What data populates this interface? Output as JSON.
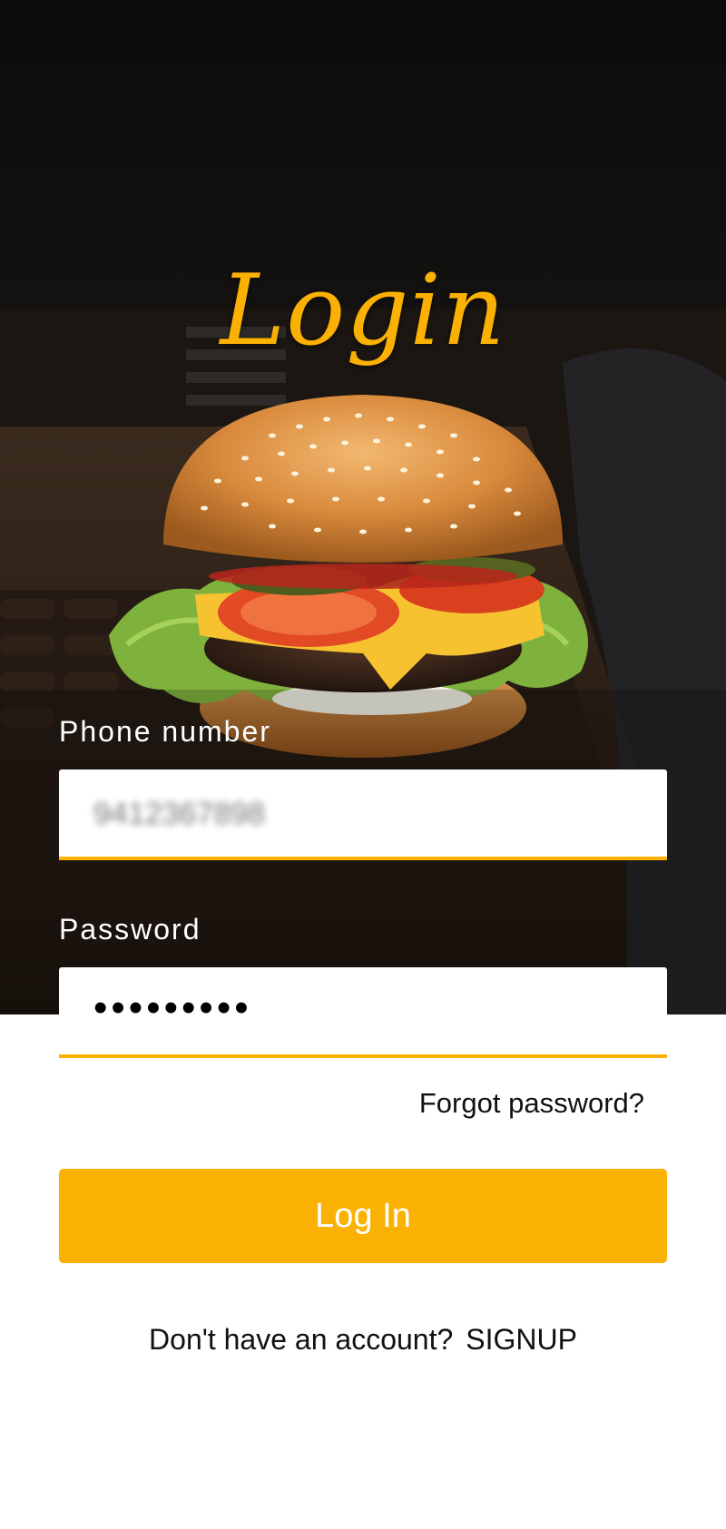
{
  "header": {
    "title": "Login"
  },
  "hero_image": {
    "subject": "burger photo"
  },
  "form": {
    "phone": {
      "label": "Phone number",
      "value": "9412367898"
    },
    "password": {
      "label": "Password",
      "value": "•••••••••"
    },
    "forgot_label": "Forgot password?",
    "login_label": "Log In"
  },
  "footer": {
    "prompt": "Don't have an account?",
    "signup_label": "SIGNUP"
  },
  "colors": {
    "accent": "#fbb104",
    "background_dark": "#141210",
    "text_dark": "#111111",
    "white": "#ffffff"
  }
}
